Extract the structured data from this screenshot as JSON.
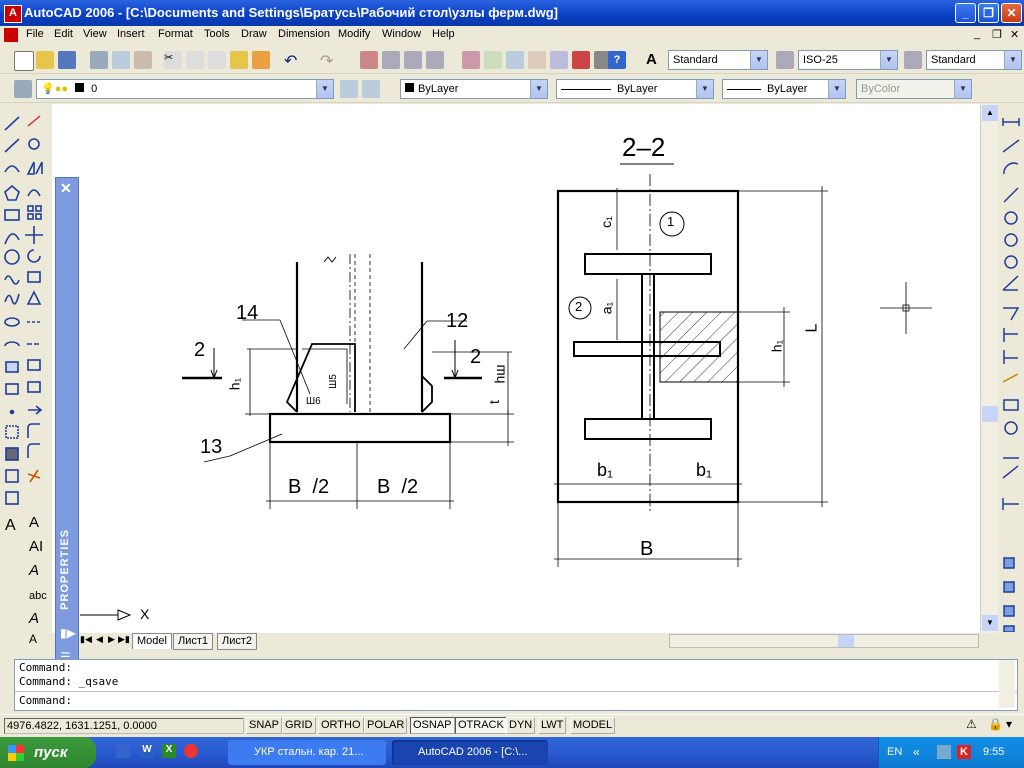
{
  "window": {
    "title": "AutoCAD 2006 - [C:\\Documents and Settings\\Братусь\\Рабочий стол\\узлы ферм.dwg]"
  },
  "menu": [
    "File",
    "Edit",
    "View",
    "Insert",
    "Format",
    "Tools",
    "Draw",
    "Dimension",
    "Modify",
    "Window",
    "Help"
  ],
  "styles_toolbar": {
    "text_style": "Standard",
    "dim_style": "ISO-25",
    "table_style": "Standard"
  },
  "layers_toolbar": {
    "layer": "0",
    "color": "ByLayer",
    "linetype": "ByLayer",
    "lineweight": "ByLayer",
    "plot_style": "ByColor"
  },
  "palette": {
    "title": "PROPERTIES"
  },
  "tabs": [
    "Model",
    "Лист1",
    "Лист2"
  ],
  "drawing": {
    "section_title": "2–2",
    "labels": {
      "n14": "14",
      "n12": "12",
      "n13": "13",
      "n2a": "2",
      "n2b": "2",
      "h1": "h₁",
      "hw": "hш",
      "t": "t",
      "sh5": "Ш5",
      "sh6": "Ш6",
      "half_b_left": "B  /2",
      "half_b_right": "B  /2",
      "c1": "c₁",
      "a1": "a₁",
      "circle1": "1",
      "circle2": "2",
      "b1_left": "b₁",
      "b1_right": "b₁",
      "L": "L",
      "h1_right": "h₁",
      "B": "B"
    },
    "ucs_x": "X"
  },
  "command": {
    "line1": "Command:",
    "line2": "Command: _qsave",
    "prompt": "Command:"
  },
  "status": {
    "coords": "4976.4822, 1631.1251, 0.0000",
    "buttons": [
      "SNAP",
      "GRID",
      "ORTHO",
      "POLAR",
      "OSNAP",
      "OTRACK",
      "DYN",
      "LWT",
      "MODEL"
    ]
  },
  "taskbar": {
    "start": "пуск",
    "tasks": [
      "УКР стальн. кар. 21...",
      "AutoCAD 2006 - [C:\\..."
    ],
    "lang": "EN",
    "clock": "9:55"
  },
  "colors": {
    "titlebar": "#0a3fc4",
    "canvas": "#ffffff",
    "palette": "#7e9be0",
    "taskbar": "#2a5ad0",
    "start": "#2f862f"
  }
}
